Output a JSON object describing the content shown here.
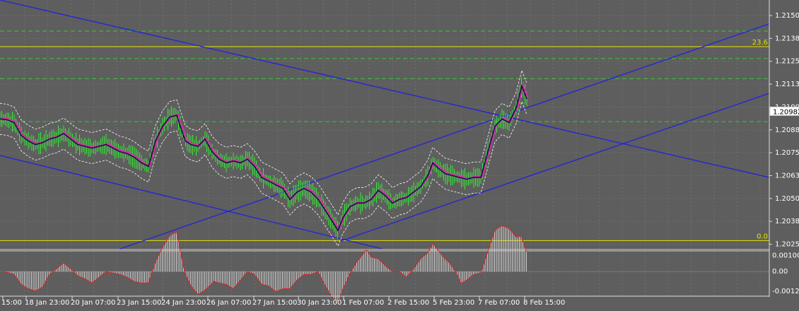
{
  "chart_data": {
    "type": "line",
    "instrument_chart": "candlestick price chart with channel lines, fibonacci levels and oscillator",
    "price_axis": {
      "ylim": [
        1.2023,
        1.2159
      ],
      "ticks": [
        "1.21505",
        "1.21380",
        "1.21255",
        "1.21130",
        "1.21005",
        "1.20880",
        "1.20755",
        "1.20630",
        "1.20505",
        "1.20380",
        "1.20255"
      ],
      "current_price": "1.20982"
    },
    "fib_levels": [
      {
        "label": "23.6",
        "value": 1.21335
      },
      {
        "label": "0.0",
        "value": 1.20275
      }
    ],
    "dashed_levels": [
      1.2142,
      1.2127,
      1.2116,
      1.20925
    ],
    "time_axis": {
      "ticks": [
        "15:00",
        "18 Jan 23:00",
        "20 Jan 07:00",
        "23 Jan 15:00",
        "24 Jan 23:00",
        "26 Jan 07:00",
        "27 Jan 15:00",
        "30 Jan 23:00",
        "1 Feb 07:00",
        "2 Feb 15:00",
        "5 Feb 23:00",
        "7 Feb 07:00",
        "8 Feb 15:00"
      ]
    },
    "price_series": [
      [
        0,
        1.2094
      ],
      [
        10,
        1.20935
      ],
      [
        20,
        1.2092
      ],
      [
        30,
        1.2085
      ],
      [
        40,
        1.2082
      ],
      [
        50,
        1.208
      ],
      [
        60,
        1.2081
      ],
      [
        70,
        1.2083
      ],
      [
        80,
        1.2084
      ],
      [
        90,
        1.2086
      ],
      [
        100,
        1.2083
      ],
      [
        110,
        1.208
      ],
      [
        120,
        1.2079
      ],
      [
        130,
        1.2078
      ],
      [
        140,
        1.2079
      ],
      [
        150,
        1.208
      ],
      [
        160,
        1.2078
      ],
      [
        170,
        1.2076
      ],
      [
        180,
        1.2075
      ],
      [
        190,
        1.2073
      ],
      [
        200,
        1.207
      ],
      [
        210,
        1.2068
      ],
      [
        220,
        1.2082
      ],
      [
        230,
        1.209
      ],
      [
        240,
        1.2095
      ],
      [
        250,
        1.2096
      ],
      [
        255,
        1.209
      ],
      [
        262,
        1.2082
      ],
      [
        270,
        1.208
      ],
      [
        280,
        1.2079
      ],
      [
        290,
        1.2083
      ],
      [
        300,
        1.2076
      ],
      [
        310,
        1.2072
      ],
      [
        320,
        1.207
      ],
      [
        330,
        1.2071
      ],
      [
        340,
        1.207
      ],
      [
        350,
        1.2072
      ],
      [
        360,
        1.2068
      ],
      [
        370,
        1.2062
      ],
      [
        380,
        1.206
      ],
      [
        390,
        1.2058
      ],
      [
        400,
        1.2056
      ],
      [
        410,
        1.205
      ],
      [
        420,
        1.2054
      ],
      [
        430,
        1.2056
      ],
      [
        440,
        1.2054
      ],
      [
        450,
        1.205
      ],
      [
        460,
        1.2044
      ],
      [
        470,
        1.2038
      ],
      [
        478,
        1.2033
      ],
      [
        485,
        1.204
      ],
      [
        495,
        1.2046
      ],
      [
        505,
        1.2048
      ],
      [
        515,
        1.2048
      ],
      [
        525,
        1.205
      ],
      [
        535,
        1.2055
      ],
      [
        545,
        1.2052
      ],
      [
        555,
        1.2048
      ],
      [
        565,
        1.205
      ],
      [
        575,
        1.2051
      ],
      [
        585,
        1.2054
      ],
      [
        595,
        1.2057
      ],
      [
        605,
        1.2063
      ],
      [
        612,
        1.207
      ],
      [
        620,
        1.2067
      ],
      [
        630,
        1.2064
      ],
      [
        640,
        1.2063
      ],
      [
        650,
        1.2062
      ],
      [
        660,
        1.2061
      ],
      [
        670,
        1.2062
      ],
      [
        680,
        1.2062
      ],
      [
        690,
        1.2076
      ],
      [
        700,
        1.209
      ],
      [
        710,
        1.2094
      ],
      [
        720,
        1.2092
      ],
      [
        730,
        1.21
      ],
      [
        738,
        1.2112
      ],
      [
        745,
        1.2105
      ]
    ],
    "oscillator": {
      "ticks": [
        "0.001005",
        "0.00",
        "-0.00123"
      ],
      "ylim": [
        -0.0015,
        0.00125
      ]
    }
  }
}
